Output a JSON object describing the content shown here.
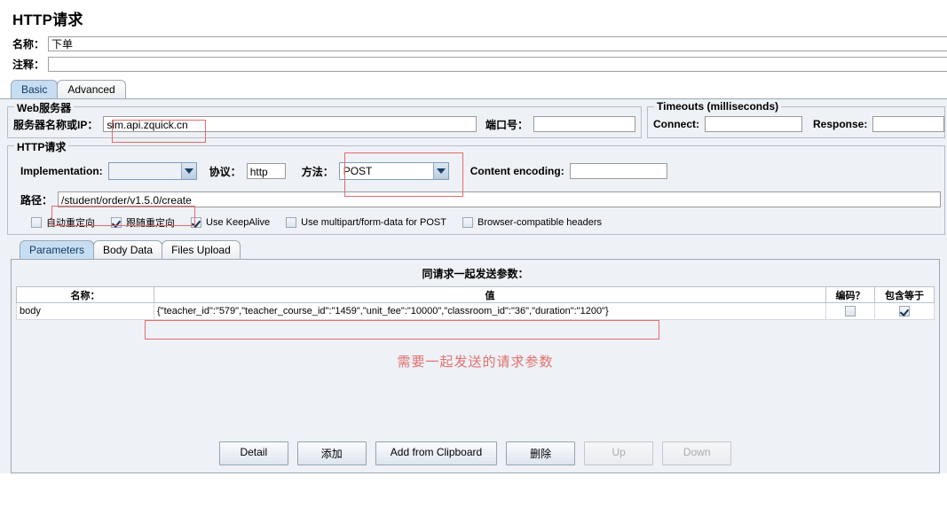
{
  "panel": {
    "title": "HTTP请求",
    "name_label": "名称：",
    "name_value": "下单",
    "comment_label": "注释：",
    "comment_value": ""
  },
  "tabs": [
    {
      "label": "Basic",
      "active": true
    },
    {
      "label": "Advanced",
      "active": false
    }
  ],
  "web_server": {
    "group_label": "Web服务器",
    "server_label": "服务器名称或IP：",
    "server_value": "sim.api.zquick.cn",
    "port_label": "端口号：",
    "port_value": ""
  },
  "timeouts": {
    "group_label": "Timeouts (milliseconds)",
    "connect_label": "Connect:",
    "connect_value": "",
    "response_label": "Response:",
    "response_value": ""
  },
  "http_request": {
    "group_label": "HTTP请求",
    "implementation_label": "Implementation:",
    "implementation_value": "",
    "protocol_label": "协议：",
    "protocol_value": "http",
    "method_label": "方法：",
    "method_value": "POST",
    "content_encoding_label": "Content encoding:",
    "content_encoding_value": "",
    "path_label": "路径：",
    "path_value": "/student/order/v1.5.0/create"
  },
  "options": [
    {
      "label": "自动重定向",
      "checked": false
    },
    {
      "label": "跟随重定向",
      "checked": true
    },
    {
      "label": "Use KeepAlive",
      "checked": true
    },
    {
      "label": "Use multipart/form-data for POST",
      "checked": false
    },
    {
      "label": "Browser-compatible headers",
      "checked": false
    }
  ],
  "inner_tabs": [
    {
      "label": "Parameters",
      "active": true
    },
    {
      "label": "Body Data",
      "active": false
    },
    {
      "label": "Files Upload",
      "active": false
    }
  ],
  "params": {
    "caption": "同请求一起发送参数：",
    "columns": [
      "名称：",
      "值",
      "编码？",
      "包含等于"
    ],
    "rows": [
      {
        "name": "body",
        "value": "{\"teacher_id\":\"579\",\"teacher_course_id\":\"1459\",\"unit_fee\":\"10000\",\"classroom_id\":\"36\",\"duration\":\"1200\"}",
        "encode": false,
        "include_equals": true
      }
    ],
    "annotation": "需要一起发送的请求参数",
    "annotation_color": "#e0706e"
  },
  "buttons": [
    {
      "label": "Detail",
      "enabled": true
    },
    {
      "label": "添加",
      "enabled": true
    },
    {
      "label": "Add from Clipboard",
      "enabled": true
    },
    {
      "label": "删除",
      "enabled": true
    },
    {
      "label": "Up",
      "enabled": false
    },
    {
      "label": "Down",
      "enabled": false
    }
  ]
}
